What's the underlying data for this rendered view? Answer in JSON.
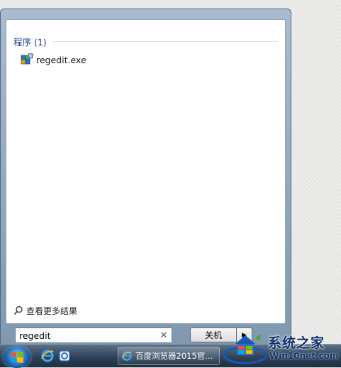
{
  "start_menu": {
    "section_title": "程序 (1)",
    "results": [
      {
        "label": "regedit.exe",
        "icon": "regedit-icon"
      }
    ],
    "more_results": "查看更多结果",
    "search": {
      "value": "regedit",
      "clear_icon": "clear-icon"
    },
    "shutdown_label": "关机",
    "shutdown_arrow": "▶"
  },
  "taskbar": {
    "window_button": {
      "label": "百度浏览器2015官...",
      "icon": "ie-icon"
    },
    "pinned": [
      "ie-icon",
      "app-icon"
    ]
  },
  "watermark": {
    "title": "系统之家",
    "url": "Win10net.com"
  },
  "colors": {
    "section_title": "#1e3a8a",
    "taskbar": "#2e4258",
    "watermark_text": "#0f2f6a"
  }
}
